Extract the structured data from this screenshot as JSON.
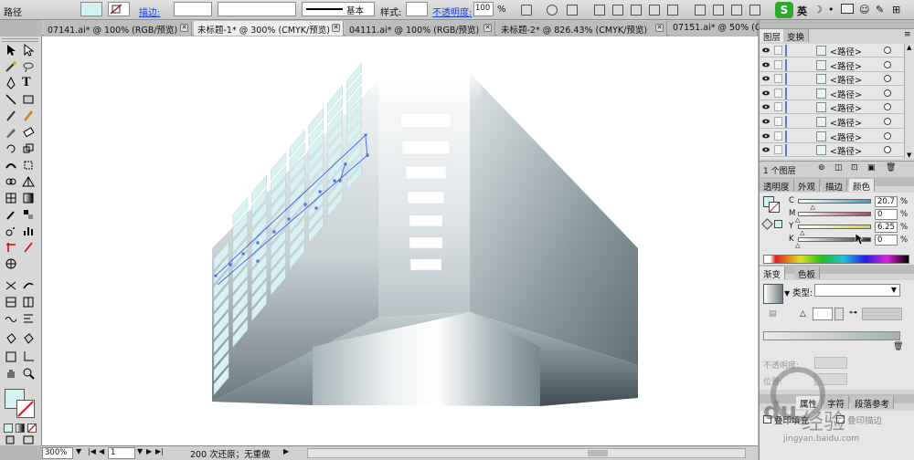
{
  "toolbar": {
    "object_label": "路径",
    "stroke_label": "描边:",
    "brush_label": "基本",
    "style_label": "样式:",
    "opacity_label": "不透明度:",
    "opacity_value": "100",
    "opacity_unit": "%",
    "ime_label": "英"
  },
  "tabs": [
    {
      "label": "07141.ai* @ 100% (RGB/预览)",
      "active": false
    },
    {
      "label": "未标题-1* @ 300% (CMYK/预览)",
      "active": true
    },
    {
      "label": "04111.ai* @ 100% (RGB/预览)",
      "active": false
    },
    {
      "label": "未标题-2* @ 826.43% (CMYK/预览)",
      "active": false
    },
    {
      "label": "07151.ai* @ 50% (C",
      "active": false
    }
  ],
  "layers_panel": {
    "tabs": [
      "图层",
      "变换"
    ],
    "rows": [
      "<路径>",
      "<路径>",
      "<路径>",
      "<路径>",
      "<路径>",
      "<路径>",
      "<路径>",
      "<路径>"
    ],
    "footer": "1 个图层"
  },
  "color_panel": {
    "tabs": [
      "透明度",
      "外观",
      "描边",
      "颜色"
    ],
    "active_tab": "颜色",
    "channels": [
      {
        "label": "C",
        "value": "20.7",
        "unit": "%",
        "color": "#29a6d6",
        "level": 0.207
      },
      {
        "label": "M",
        "value": "0",
        "unit": "%",
        "color": "#c2337a",
        "level": 0
      },
      {
        "label": "Y",
        "value": "6.25",
        "unit": "%",
        "color": "#d8d23a",
        "level": 0.0625
      },
      {
        "label": "K",
        "value": "0",
        "unit": "%",
        "color": "#333333",
        "level": 0
      }
    ]
  },
  "gradient_panel": {
    "tabs": [
      "渐变",
      "色板"
    ],
    "type_label": "类型:",
    "opacity_label": "不透明度:",
    "position_label": "位置:"
  },
  "bottom_panel": {
    "tabs": [
      "属性",
      "字符",
      "段落参考"
    ],
    "overprint_fill": "叠印填充",
    "overprint_stroke": "叠印描边"
  },
  "status": {
    "zoom": "300%",
    "page": "1",
    "history": "200 次还原；无重做"
  },
  "watermark": {
    "brand": "du",
    "text": "经验",
    "sub": "jingyan.baidu.com"
  },
  "colors": {
    "fill_swatch": "#d6f1f2",
    "accent": "#4a6be0"
  }
}
